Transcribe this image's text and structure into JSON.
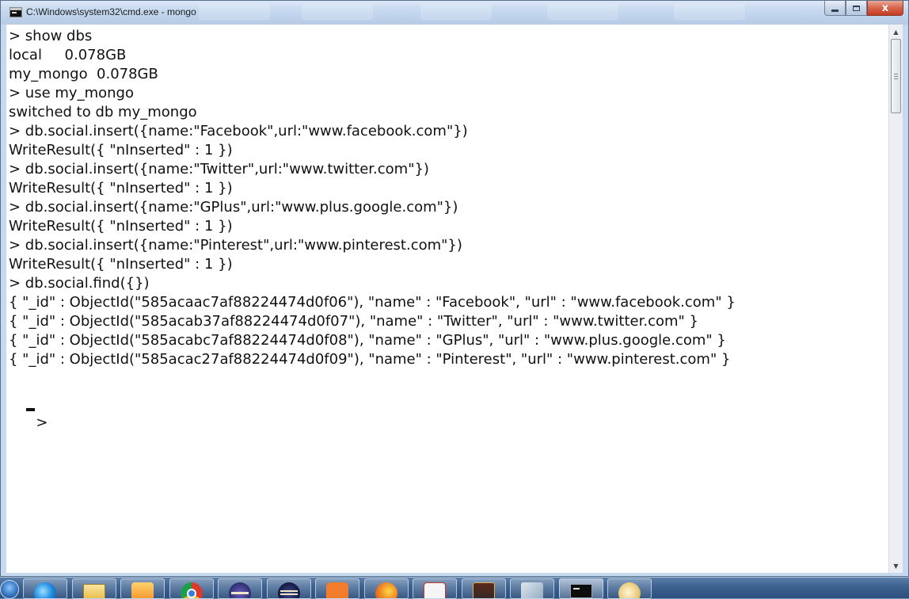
{
  "window": {
    "title": "C:\\Windows\\system32\\cmd.exe - mongo",
    "minimize_label": "",
    "maximize_label": "",
    "close_label": "x"
  },
  "console": {
    "lines": [
      "> show dbs",
      "local     0.078GB",
      "my_mongo  0.078GB",
      "> use my_mongo",
      "switched to db my_mongo",
      "> db.social.insert({name:\"Facebook\",url:\"www.facebook.com\"})",
      "WriteResult({ \"nInserted\" : 1 })",
      "> db.social.insert({name:\"Twitter\",url:\"www.twitter.com\"})",
      "WriteResult({ \"nInserted\" : 1 })",
      "> db.social.insert({name:\"GPlus\",url:\"www.plus.google.com\"})",
      "WriteResult({ \"nInserted\" : 1 })",
      "> db.social.insert({name:\"Pinterest\",url:\"www.pinterest.com\"})",
      "WriteResult({ \"nInserted\" : 1 })",
      "> db.social.find({})",
      "{ \"_id\" : ObjectId(\"585acaac7af88224474d0f06\"), \"name\" : \"Facebook\", \"url\" : \"www.facebook.com\" }",
      "{ \"_id\" : ObjectId(\"585acab37af88224474d0f07\"), \"name\" : \"Twitter\", \"url\" : \"www.twitter.com\" }",
      "{ \"_id\" : ObjectId(\"585acabc7af88224474d0f08\"), \"name\" : \"GPlus\", \"url\" : \"www.plus.google.com\" }",
      "{ \"_id\" : ObjectId(\"585acac27af88224474d0f09\"), \"name\" : \"Pinterest\", \"url\" : \"www.pinterest.com\" }"
    ],
    "prompt": ">"
  },
  "taskbar": {
    "items": [
      {
        "name": "internet-explorer-icon",
        "icon_class": "ic-ie",
        "active": false
      },
      {
        "name": "file-explorer-icon",
        "icon_class": "ic-folder",
        "active": false
      },
      {
        "name": "media-player-icon",
        "icon_class": "ic-media",
        "active": false
      },
      {
        "name": "chrome-icon",
        "icon_class": "ic-chrome",
        "active": false
      },
      {
        "name": "eclipse-icon",
        "icon_class": "ic-eclipse",
        "active": false
      },
      {
        "name": "eclipse-workspace-icon",
        "icon_class": "ic-eclipse2",
        "active": false
      },
      {
        "name": "xampp-icon",
        "icon_class": "ic-xampp",
        "active": false
      },
      {
        "name": "firefox-icon",
        "icon_class": "ic-firefox",
        "active": false
      },
      {
        "name": "snipping-tool-icon",
        "icon_class": "ic-snip",
        "active": false
      },
      {
        "name": "java-ee-ide-icon",
        "icon_class": "ic-javaee",
        "active": false
      },
      {
        "name": "tool-icon",
        "icon_class": "ic-tool",
        "active": false
      },
      {
        "name": "command-prompt-icon",
        "icon_class": "ic-cmd",
        "active": true
      },
      {
        "name": "paint-icon",
        "icon_class": "ic-paint",
        "active": false
      }
    ]
  }
}
